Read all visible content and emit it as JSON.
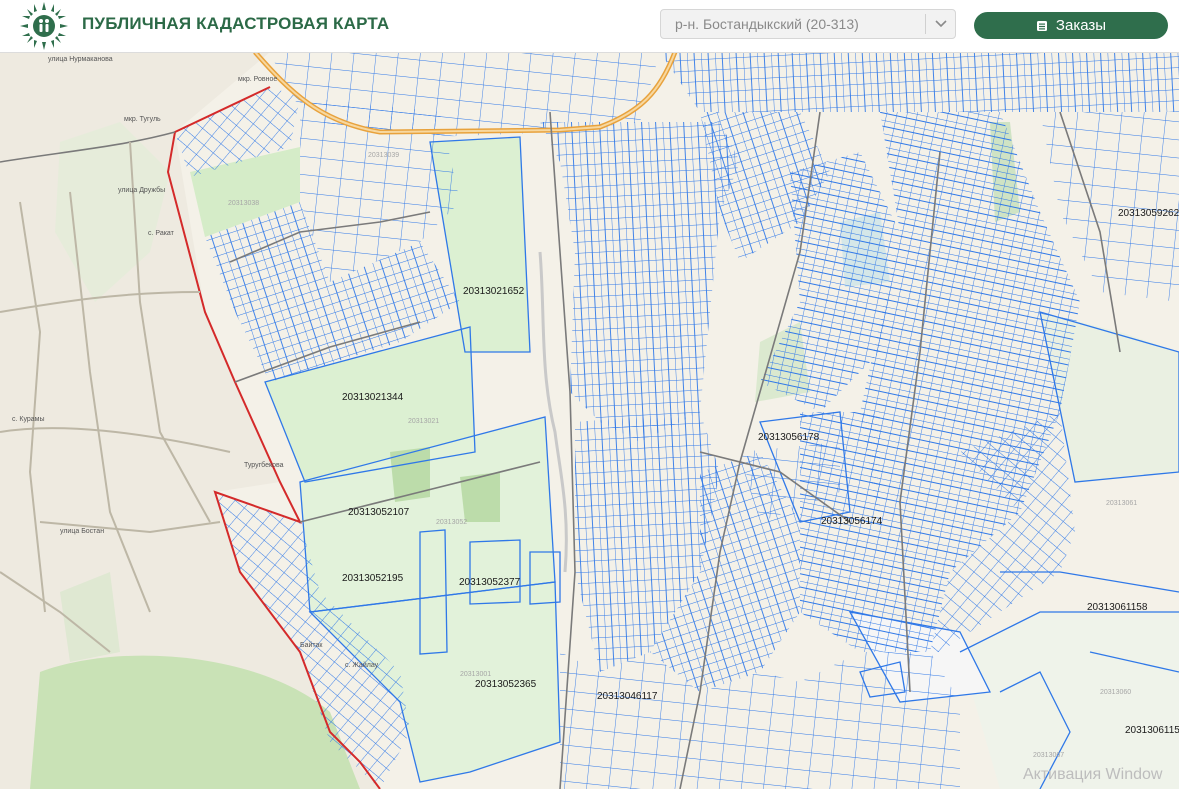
{
  "header": {
    "title": "ПУБЛИЧНАЯ КАДАСТРОВАЯ КАРТА",
    "district_select": {
      "value": "р-н. Бостандыкский (20-313)"
    },
    "orders_button": {
      "label": "Заказы",
      "icon": "list-icon"
    }
  },
  "map": {
    "parcel_labels": [
      "20313021652",
      "20313021344",
      "20313052107",
      "20313052195",
      "20313052377",
      "20313052365",
      "20313046117",
      "20313056178",
      "20313056174",
      "20313061158",
      "20313059262",
      "2031306115"
    ],
    "block_labels": [
      "20313038",
      "20313039",
      "20313021",
      "20313052",
      "20313001",
      "20313061",
      "20313060",
      "20313067"
    ],
    "street_labels": [
      "улица Нурмаканова",
      "мкр. Тугуль",
      "мкр. Ровное",
      "улица Дружбы",
      "с. Ракат",
      "Туругбекова",
      "с. Курамы",
      "с. Жайлау",
      "Байтак",
      "улица Бостан"
    ],
    "colors": {
      "parcel_lines": "#2f78e8",
      "district_boundary": "#d42a2a",
      "highway": "#e8a23c",
      "greenery": "#dcebd4"
    },
    "watermark": "Активация Window"
  }
}
